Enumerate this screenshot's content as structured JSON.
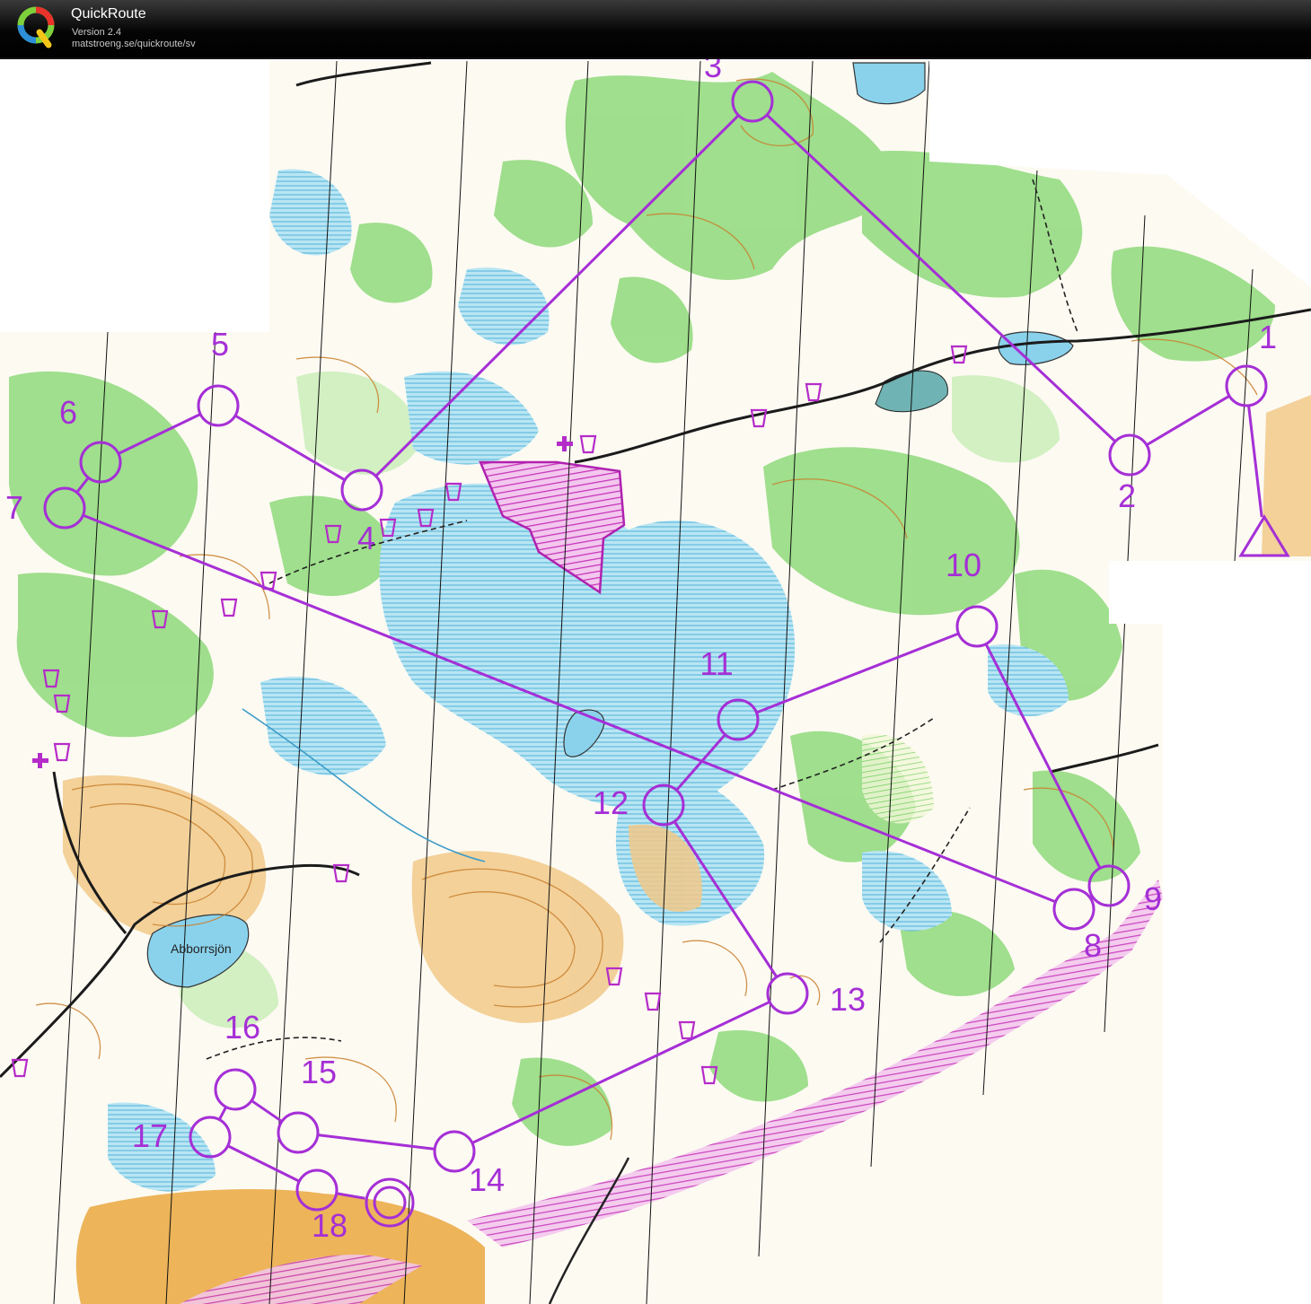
{
  "app": {
    "title": "QuickRoute",
    "version": "Version 2.4",
    "url": "matstroeng.se/quickroute/sv"
  },
  "map": {
    "lake_label": "Abborrsjön",
    "colors": {
      "course": "#a52fd6",
      "forest": "#8ed97c",
      "forest_light": "#c6ecb6",
      "marsh_water": "#b8e4f2",
      "lake": "#8dd3ec",
      "open_land": "#f0c46e",
      "contour": "#c87b2a",
      "road": "#1a1a1a",
      "background": "#fdfaf2"
    },
    "controls": [
      {
        "label": "1"
      },
      {
        "label": "2"
      },
      {
        "label": "3"
      },
      {
        "label": "4"
      },
      {
        "label": "5"
      },
      {
        "label": "6"
      },
      {
        "label": "7"
      },
      {
        "label": "8"
      },
      {
        "label": "9"
      },
      {
        "label": "10"
      },
      {
        "label": "11"
      },
      {
        "label": "12"
      },
      {
        "label": "13"
      },
      {
        "label": "14"
      },
      {
        "label": "15"
      },
      {
        "label": "16"
      },
      {
        "label": "17"
      },
      {
        "label": "18"
      }
    ]
  }
}
